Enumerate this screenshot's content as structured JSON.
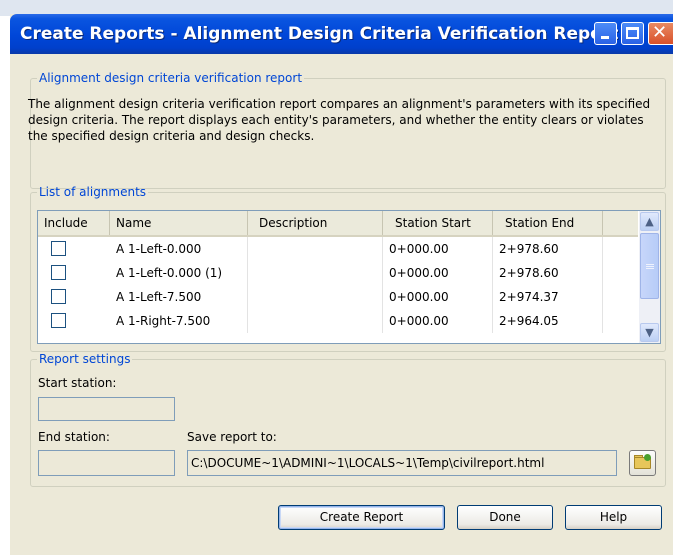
{
  "window": {
    "title": "Create Reports - Alignment Design Criteria Verification Report",
    "title_color": "#0046d8",
    "controls": [
      "minimize-icon",
      "maximize-icon",
      "close-icon"
    ]
  },
  "report_group": {
    "legend": "Alignment design criteria verification report",
    "description": "The alignment design criteria verification report compares an alignment's parameters with its specified design criteria. The report displays each entity's parameters, and whether the entity clears or violates the specified design criteria and design checks."
  },
  "alignments_group": {
    "legend": "List of alignments",
    "columns": [
      "Include",
      "Name",
      "Description",
      "Station Start",
      "Station End"
    ],
    "rows": [
      {
        "include": false,
        "name": "A 1-Left-0.000",
        "description": "",
        "station_start": "0+000.00",
        "station_end": "2+978.60"
      },
      {
        "include": false,
        "name": "A 1-Left-0.000 (1)",
        "description": "",
        "station_start": "0+000.00",
        "station_end": "2+978.60"
      },
      {
        "include": false,
        "name": "A 1-Left-7.500",
        "description": "",
        "station_start": "0+000.00",
        "station_end": "2+974.37"
      },
      {
        "include": false,
        "name": "A 1-Right-7.500",
        "description": "",
        "station_start": "0+000.00",
        "station_end": "2+964.05"
      }
    ]
  },
  "settings_group": {
    "legend": "Report settings",
    "start_station_label": "Start station:",
    "start_station_value": "",
    "end_station_label": "End station:",
    "end_station_value": "",
    "save_label": "Save report to:",
    "save_path": "C:\\DOCUME~1\\ADMINI~1\\LOCALS~1\\Temp\\civilreport.html",
    "browse_icon": "folder-browse-icon"
  },
  "buttons": {
    "create": "Create Report",
    "done": "Done",
    "help": "Help"
  },
  "colors": {
    "dialog_bg": "#ece9d8",
    "legend_text": "#0046d5"
  }
}
